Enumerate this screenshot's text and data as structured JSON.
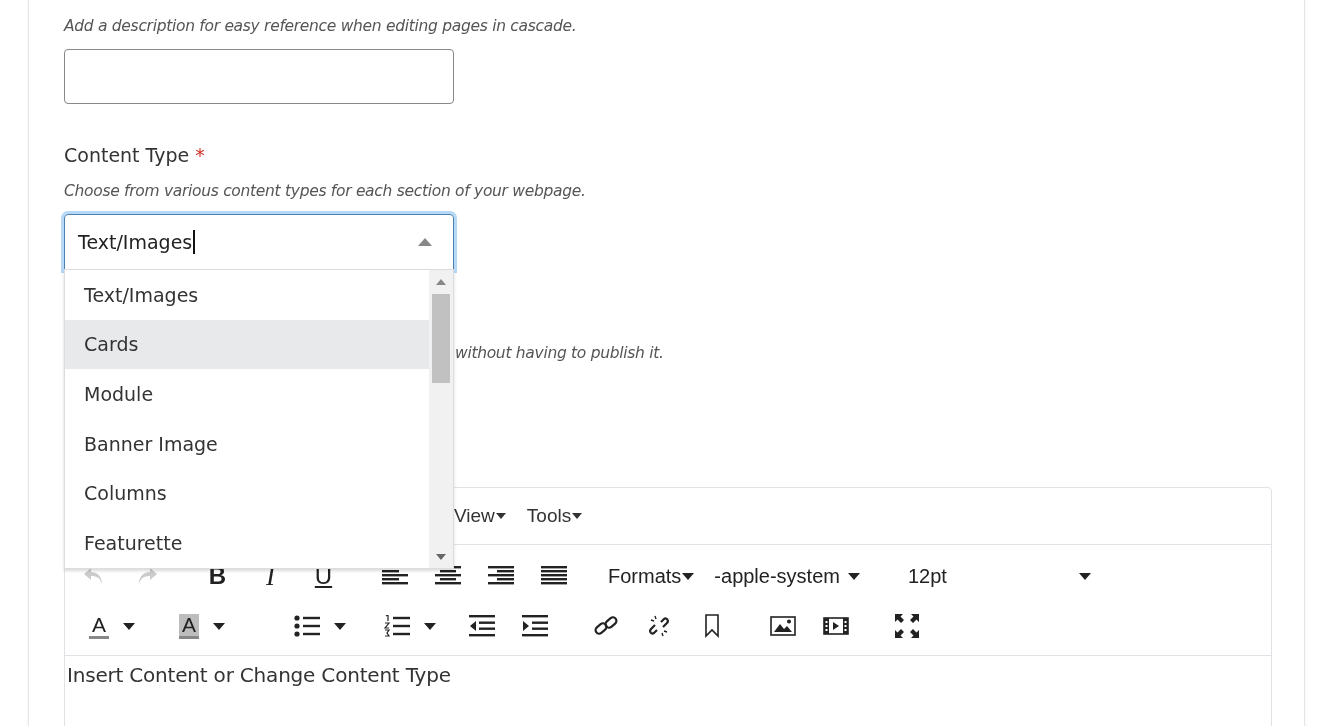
{
  "description_field": {
    "hint": "Add a description for easy reference when editing pages in cascade."
  },
  "content_type": {
    "label": "Content Type",
    "required_mark": "*",
    "hint": "Choose from various content types for each section of your webpage.",
    "value": "Text/Images",
    "expanded": true,
    "options": [
      {
        "label": "Text/Images",
        "highlighted": false
      },
      {
        "label": "Cards",
        "highlighted": true
      },
      {
        "label": "Module",
        "highlighted": false
      },
      {
        "label": "Banner Image",
        "highlighted": false
      },
      {
        "label": "Columns",
        "highlighted": false
      },
      {
        "label": "Featurette",
        "highlighted": false
      }
    ]
  },
  "hidden_hint": "without having to publish it.",
  "editor": {
    "menus": [
      "View",
      "Tools"
    ],
    "undo": {
      "disabled": true
    },
    "redo": {
      "disabled": true
    },
    "format_buttons": [
      "B",
      "I",
      "U"
    ],
    "dropdowns": [
      {
        "label": "Formats",
        "kind": "tight"
      },
      {
        "label": "-apple-system",
        "kind": "normal"
      },
      {
        "label": "12pt",
        "kind": "wide"
      }
    ],
    "color_buttons": [
      {
        "label": "A",
        "kind": "text"
      },
      {
        "label": "A",
        "kind": "highlight"
      }
    ],
    "content": "Insert Content or Change Content Type"
  }
}
